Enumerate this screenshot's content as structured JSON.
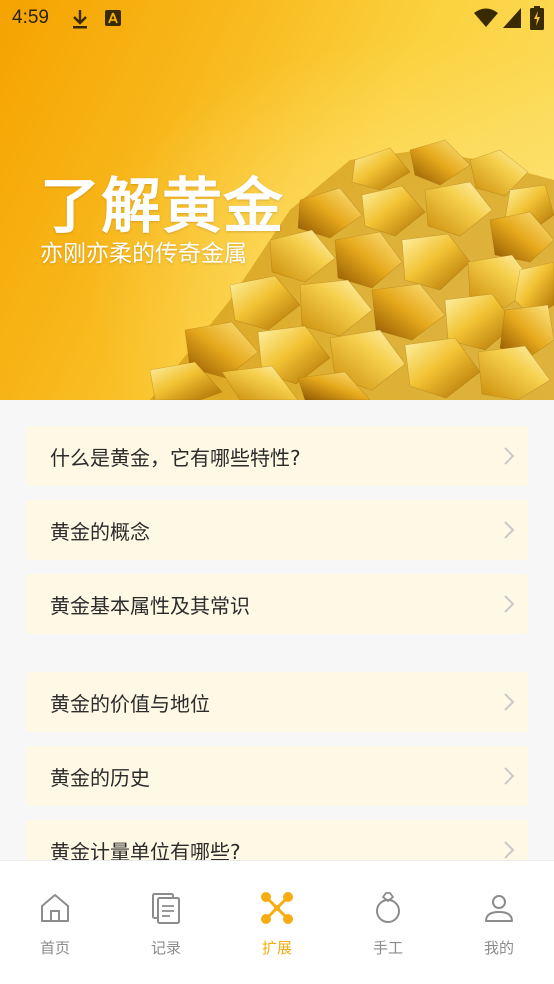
{
  "status_bar": {
    "time": "4:59"
  },
  "hero": {
    "title": "了解黄金",
    "subtitle": "亦刚亦柔的传奇金属"
  },
  "list": {
    "items": [
      {
        "label": "什么是黄金，它有哪些特性?"
      },
      {
        "label": "黄金的概念"
      },
      {
        "label": "黄金基本属性及其常识"
      },
      {
        "label": "黄金的价值与地位"
      },
      {
        "label": "黄金的历史"
      },
      {
        "label": "黄金计量单位有哪些?"
      }
    ]
  },
  "bottom_nav": {
    "items": [
      {
        "label": "首页",
        "icon": "home-icon",
        "active": false
      },
      {
        "label": "记录",
        "icon": "records-icon",
        "active": false
      },
      {
        "label": "扩展",
        "icon": "extend-icon",
        "active": true
      },
      {
        "label": "手工",
        "icon": "ring-icon",
        "active": false
      },
      {
        "label": "我的",
        "icon": "profile-icon",
        "active": false
      }
    ]
  },
  "colors": {
    "accent": "#f7ad12",
    "item_background": "#fff8e5",
    "nav_inactive": "#8c8c8c"
  }
}
